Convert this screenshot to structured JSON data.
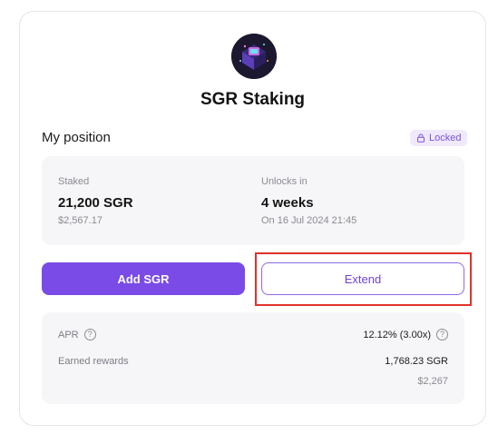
{
  "header": {
    "title": "SGR Staking"
  },
  "position": {
    "section_label": "My position",
    "status_badge": "Locked",
    "staked": {
      "label": "Staked",
      "value": "21,200 SGR",
      "usd": "$2,567.17"
    },
    "unlocks": {
      "label": "Unlocks in",
      "value": "4 weeks",
      "date": "On 16 Jul 2024 21:45"
    }
  },
  "actions": {
    "add_label": "Add SGR",
    "extend_label": "Extend"
  },
  "stats": {
    "apr": {
      "label": "APR",
      "value": "12.12% (3.00x)"
    },
    "rewards": {
      "label": "Earned rewards",
      "value": "1,768.23 SGR",
      "usd": "$2,267"
    }
  },
  "colors": {
    "accent": "#7a4be6",
    "highlight": "#e0312a",
    "badge_bg": "#f0e9fb"
  }
}
